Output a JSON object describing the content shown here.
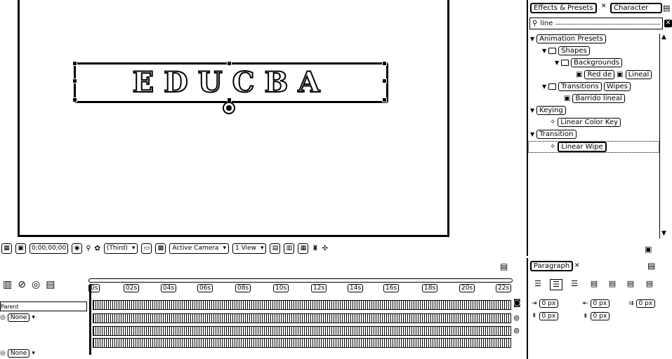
{
  "composition": {
    "logo_text": "EDUCBA",
    "toolbar": {
      "timecode": "0;00;00;00",
      "resolution": "(Third)",
      "camera": "Active Camera",
      "view": "1 View"
    }
  },
  "effects_panel": {
    "tabs": [
      {
        "label": "Effects & Presets"
      },
      {
        "label": "Character"
      }
    ],
    "search": {
      "value": "line"
    },
    "tree": [
      {
        "label": "Animation Presets",
        "depth": 0,
        "type": "category"
      },
      {
        "label": "Shapes",
        "depth": 1,
        "type": "folder"
      },
      {
        "label": "Backgrounds",
        "depth": 2,
        "type": "folder"
      },
      {
        "label": "Red de",
        "depth": 3,
        "type": "preset",
        "extra": "Lineal"
      },
      {
        "label": "Transitions",
        "depth": 1,
        "type": "folder",
        "extra": "Wipes"
      },
      {
        "label": "Barrido lineal",
        "depth": 2,
        "type": "preset"
      },
      {
        "label": "Keying",
        "depth": 0,
        "type": "category"
      },
      {
        "label": "Linear Color Key",
        "depth": 1,
        "type": "effect"
      },
      {
        "label": "Transition",
        "depth": 0,
        "type": "category"
      },
      {
        "label": "Linear Wipe",
        "depth": 1,
        "type": "effect",
        "selected": true
      }
    ]
  },
  "timeline": {
    "ticks": [
      "0s",
      "02s",
      "04s",
      "06s",
      "08s",
      "10s",
      "12s",
      "14s",
      "16s",
      "18s",
      "20s",
      "22s"
    ],
    "search_label": "Parent",
    "layers": [
      {
        "parent": "None"
      },
      {
        "parent": "None"
      }
    ]
  },
  "paragraph_panel": {
    "tab_label": "Paragraph",
    "indents": [
      {
        "value": "0 px"
      },
      {
        "value": "0 px"
      },
      {
        "value": "0 px"
      },
      {
        "value": "0 px"
      },
      {
        "value": "0 px"
      }
    ]
  }
}
